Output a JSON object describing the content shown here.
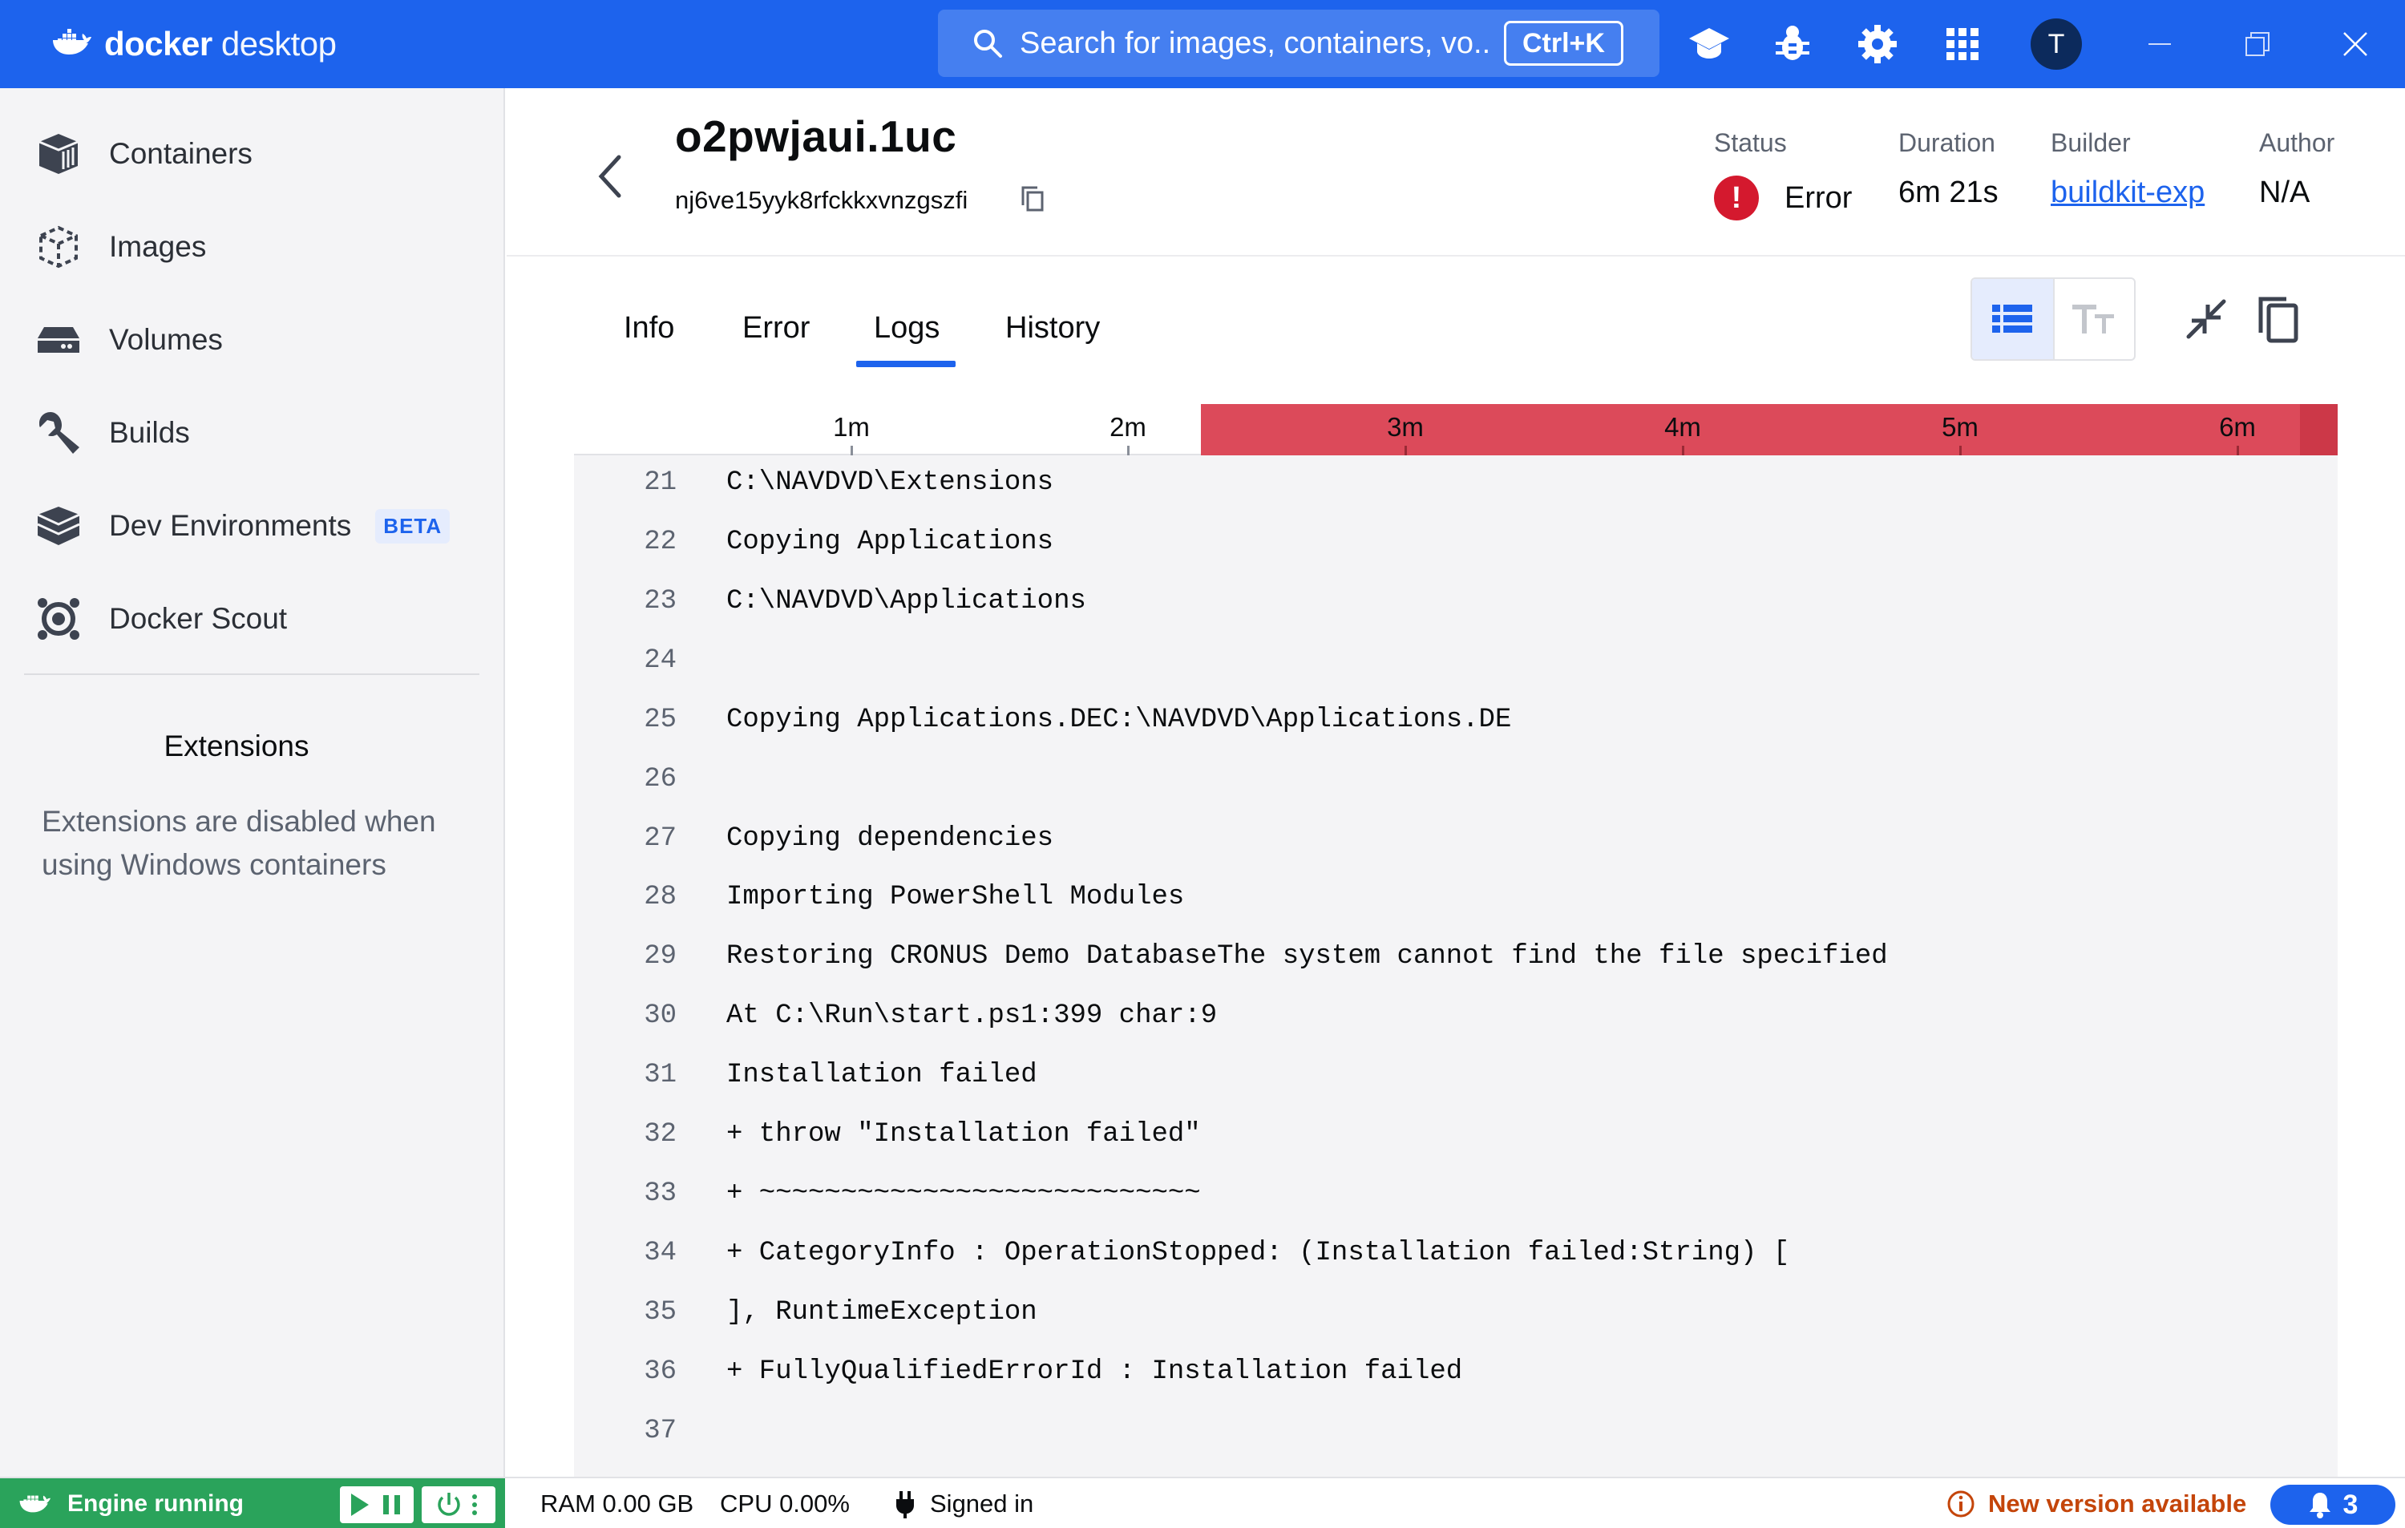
{
  "app": {
    "brand_bold": "docker",
    "brand_light": " desktop",
    "colors": {
      "primary": "#1d63ed",
      "error": "#d4192e",
      "timeline_error": "#dc4a5a",
      "engine_running": "#2aa35b",
      "update_warning": "#c4450a"
    }
  },
  "titlebar": {
    "search_placeholder": "Search for images, containers, vo...",
    "search_shortcut": "Ctrl+K",
    "icons": [
      "learn-icon",
      "bug-icon",
      "settings-icon",
      "apps-grid-icon"
    ],
    "avatar_initial": "T"
  },
  "sidebar": {
    "items": [
      {
        "label": "Containers",
        "icon": "containers-icon"
      },
      {
        "label": "Images",
        "icon": "images-icon"
      },
      {
        "label": "Volumes",
        "icon": "volumes-icon"
      },
      {
        "label": "Builds",
        "icon": "wrench-icon"
      },
      {
        "label": "Dev Environments",
        "icon": "dev-env-icon",
        "badge": "BETA"
      },
      {
        "label": "Docker Scout",
        "icon": "scout-icon"
      }
    ],
    "extensions_title": "Extensions",
    "extensions_note": "Extensions are disabled when using Windows containers"
  },
  "build": {
    "title": "o2pwjaui.1uc",
    "id": "nj6ve15yyk8rfckkxvnzgszfi",
    "status_label": "Status",
    "status_value": "Error",
    "duration_label": "Duration",
    "duration_value": "6m 21s",
    "builder_label": "Builder",
    "builder_value": "buildkit-exp",
    "author_label": "Author",
    "author_value": "N/A"
  },
  "tabs": [
    {
      "label": "Info",
      "active": false
    },
    {
      "label": "Error",
      "active": false
    },
    {
      "label": "Logs",
      "active": true
    },
    {
      "label": "History",
      "active": false
    }
  ],
  "timeline": {
    "labels": [
      "1m",
      "2m",
      "3m",
      "4m",
      "5m",
      "6m"
    ],
    "error_start_fraction": 0.355
  },
  "logs": [
    {
      "n": "21",
      "text": "C:\\NAVDVD\\Extensions"
    },
    {
      "n": "22",
      "text": "Copying Applications"
    },
    {
      "n": "23",
      "text": "C:\\NAVDVD\\Applications"
    },
    {
      "n": "24",
      "text": ""
    },
    {
      "n": "25",
      "text": "Copying Applications.DEC:\\NAVDVD\\Applications.DE"
    },
    {
      "n": "26",
      "text": ""
    },
    {
      "n": "27",
      "text": "Copying dependencies"
    },
    {
      "n": "28",
      "text": "Importing PowerShell Modules"
    },
    {
      "n": "29",
      "text": "Restoring CRONUS Demo DatabaseThe system cannot find the file specified"
    },
    {
      "n": "30",
      "text": "At C:\\Run\\start.ps1:399 char:9"
    },
    {
      "n": "31",
      "text": "Installation failed"
    },
    {
      "n": "32",
      "text": "+ throw \"Installation failed\""
    },
    {
      "n": "33",
      "text": "+ ~~~~~~~~~~~~~~~~~~~~~~~~~~~"
    },
    {
      "n": "34",
      "text": "+ CategoryInfo : OperationStopped: (Installation failed:String) ["
    },
    {
      "n": "35",
      "text": "], RuntimeException"
    },
    {
      "n": "36",
      "text": "+ FullyQualifiedErrorId : Installation failed"
    },
    {
      "n": "37",
      "text": ""
    }
  ],
  "statusbar": {
    "engine": "Engine running",
    "ram": "RAM 0.00 GB",
    "cpu": "CPU 0.00%",
    "signed_in": "Signed in",
    "update": "New version available",
    "notifications": "3"
  }
}
